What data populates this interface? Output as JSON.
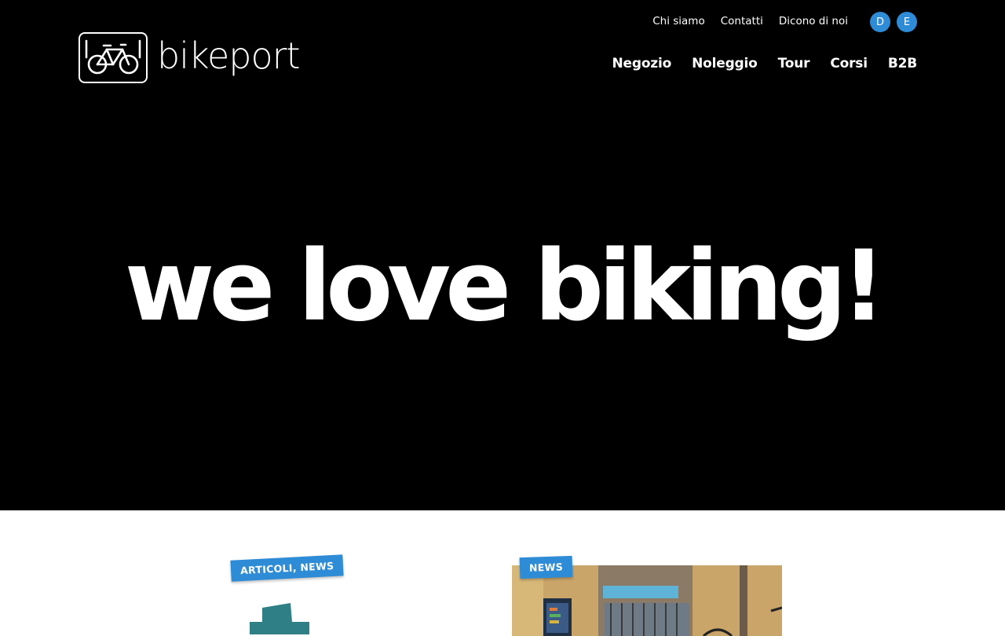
{
  "brand": {
    "name": "bikeport",
    "logo_icon": "bicycle-icon"
  },
  "top_nav": [
    {
      "label": "Chi siamo"
    },
    {
      "label": "Contatti"
    },
    {
      "label": "Dicono di noi"
    }
  ],
  "languages": [
    {
      "label": "D"
    },
    {
      "label": "E"
    }
  ],
  "main_nav": [
    {
      "label": "Negozio"
    },
    {
      "label": "Noleggio"
    },
    {
      "label": "Tour"
    },
    {
      "label": "Corsi"
    },
    {
      "label": "B2B"
    }
  ],
  "hero": {
    "headline": "we love biking!"
  },
  "cards": [
    {
      "tag": "ARTICOLI, NEWS",
      "image": "teal-graphic"
    },
    {
      "tag": "NEWS",
      "image": "shop-photo"
    }
  ],
  "colors": {
    "accent": "#2e8bd6",
    "hero_bg": "#000000",
    "teal": "#2f7f86"
  }
}
